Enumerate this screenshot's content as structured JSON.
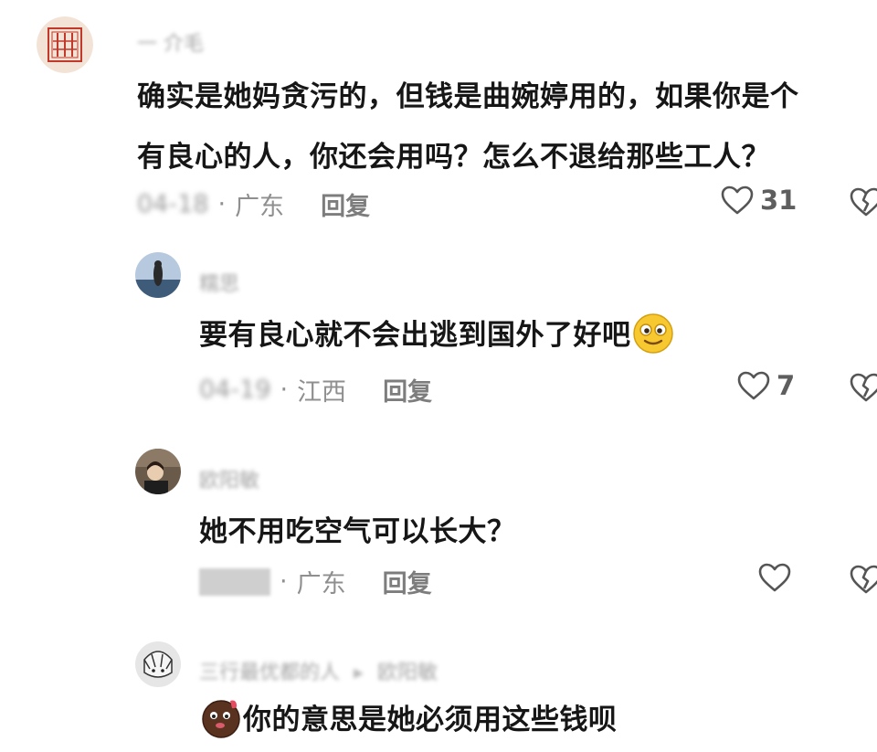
{
  "comments": [
    {
      "username": "一 介毛",
      "text_line1": "确实是她妈贪污的，但钱是曲婉婷用的，如果你是个",
      "text_line2": "有良心的人，你还会用吗？怎么不退给那些工人？",
      "date": "04-18",
      "location": "广东",
      "reply_label": "回复",
      "likes": "31"
    },
    {
      "username": "糯思",
      "text": "要有良心就不会出逃到国外了好吧",
      "date": "04-19",
      "location": "江西",
      "reply_label": "回复",
      "likes": "7"
    },
    {
      "username": "欧阳敏",
      "text": "她不用吃空气可以长大？",
      "location": "广东",
      "reply_label": "回复",
      "likes": ""
    },
    {
      "username": "三行最优都的人",
      "reply_to": "欧阳敏",
      "text": "你的意思是她必须用这些钱呗"
    }
  ],
  "icons": {
    "like": "heart-outline-icon",
    "dislike": "broken-heart-icon",
    "reply_arrow": "triangle-right-icon"
  },
  "colors": {
    "text": "#161616",
    "meta": "#8f8f8f",
    "username": "#a3a3a3",
    "emoji_yellow": "#f7c830",
    "emoji_brown": "#5a3220"
  }
}
